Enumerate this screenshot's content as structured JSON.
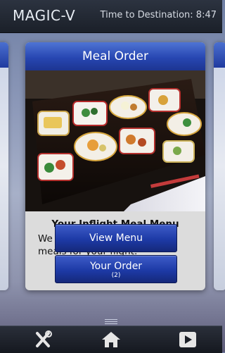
{
  "header": {
    "logo": "MAGIC-V",
    "eta_label": "Time to Destination:",
    "eta_value": "8:47"
  },
  "card": {
    "title": "Meal Order",
    "subtitle": "Your Inflight Meal Menu",
    "description": "We offer a full range onboard meals for your flight.",
    "buttons": {
      "view_menu": "View Menu",
      "your_order": "Your Order",
      "order_count": "(2)"
    }
  },
  "nav": {
    "icons": [
      "tools-icon",
      "home-icon",
      "play-icon"
    ]
  },
  "colors": {
    "accent": "#2747b2",
    "button": "#1d3aa6",
    "topbar": "#1b2029"
  }
}
